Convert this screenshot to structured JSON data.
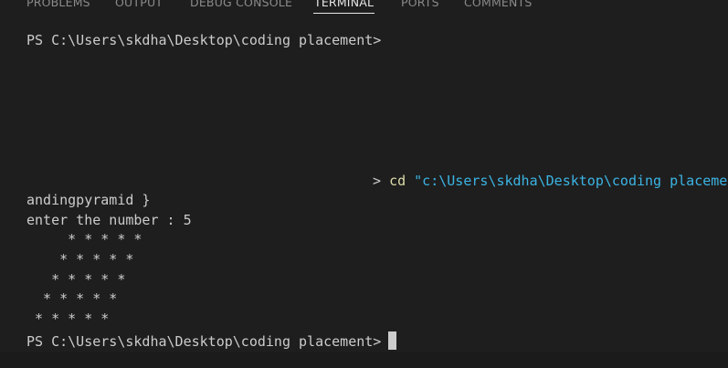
{
  "tabs": [
    {
      "label": "PROBLEMS"
    },
    {
      "label": "OUTPUT"
    },
    {
      "label": "DEBUG CONSOLE"
    },
    {
      "label": "TERMINAL"
    },
    {
      "label": "PORTS"
    },
    {
      "label": "COMMENTS"
    }
  ],
  "active_tab": "TERMINAL",
  "terminal": {
    "prompt1": "PS C:\\Users\\skdha\\Desktop\\coding placement>",
    "cmd_arrow": ">",
    "cmd_word": "cd",
    "cmd_path": "\"c:\\Users\\skdha\\Desktop\\coding placemen",
    "cont_line": "andingpyramid }",
    "output_lines": [
      "enter the number : 5",
      "     * * * * *",
      "    * * * * *",
      "   * * * * *",
      "  * * * * *",
      " * * * * *"
    ],
    "prompt2": "PS C:\\Users\\skdha\\Desktop\\coding placement>"
  },
  "colors": {
    "background": "#1e1e1e",
    "text": "#cccccc",
    "command": "#dcdcaa",
    "string": "#3bb4e4",
    "tab_inactive": "#8b8b8b",
    "tab_active": "#e7e7e7"
  }
}
